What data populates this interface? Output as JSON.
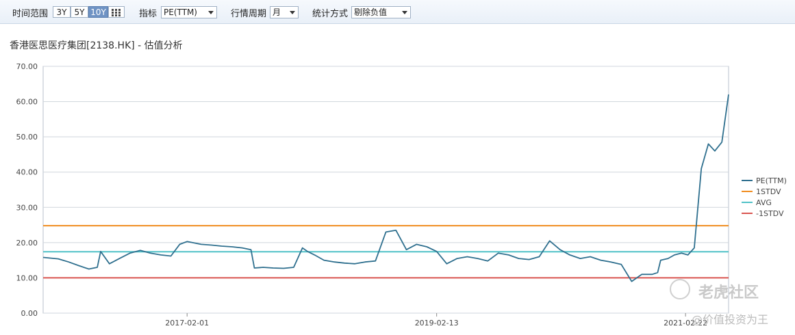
{
  "toolbar": {
    "time_range_label": "时间范围",
    "range_buttons": [
      "3Y",
      "5Y",
      "10Y"
    ],
    "active_range": "10Y",
    "indicator_label": "指标",
    "indicator_value": "PE(TTM)",
    "period_label": "行情周期",
    "period_value": "月",
    "method_label": "统计方式",
    "method_value": "剔除负值"
  },
  "watermark": {
    "brand": "老虎社区",
    "author": "@价值投资为王"
  },
  "chart_data": {
    "type": "line",
    "title": "香港医思医疗集团[2138.HK] - 估值分析",
    "xlabel": "",
    "ylabel": "",
    "ylim": [
      0,
      70
    ],
    "y_ticks": [
      "0.00",
      "10.00",
      "20.00",
      "30.00",
      "40.00",
      "50.00",
      "60.00",
      "70.00"
    ],
    "x_tick_labels": [
      "2017-02-01",
      "2019-02-13",
      "2021-02-22"
    ],
    "x_range": [
      "2015-12-01",
      "2021-06-30"
    ],
    "grid": true,
    "legend_position": "right",
    "series": [
      {
        "name": "PE(TTM)",
        "color": "#2e6f8e",
        "x": [
          "2015-12-01",
          "2016-01-15",
          "2016-02-15",
          "2016-03-15",
          "2016-04-15",
          "2016-05-10",
          "2016-05-20",
          "2016-06-15",
          "2016-07-15",
          "2016-08-15",
          "2016-09-15",
          "2016-10-15",
          "2016-11-15",
          "2016-12-15",
          "2017-01-10",
          "2017-02-01",
          "2017-03-15",
          "2017-04-15",
          "2017-05-15",
          "2017-06-15",
          "2017-07-15",
          "2017-08-10",
          "2017-08-20",
          "2017-09-15",
          "2017-10-15",
          "2017-11-15",
          "2017-12-15",
          "2018-01-10",
          "2018-01-25",
          "2018-02-15",
          "2018-03-15",
          "2018-04-15",
          "2018-05-15",
          "2018-06-15",
          "2018-07-15",
          "2018-08-15",
          "2018-09-15",
          "2018-10-15",
          "2018-11-15",
          "2018-12-15",
          "2019-01-15",
          "2019-02-13",
          "2019-03-15",
          "2019-04-15",
          "2019-05-15",
          "2019-06-15",
          "2019-07-15",
          "2019-08-15",
          "2019-09-15",
          "2019-10-15",
          "2019-11-15",
          "2019-12-15",
          "2020-01-15",
          "2020-02-15",
          "2020-03-15",
          "2020-04-15",
          "2020-05-15",
          "2020-06-15",
          "2020-07-15",
          "2020-08-15",
          "2020-09-15",
          "2020-10-15",
          "2020-11-15",
          "2020-12-01",
          "2020-12-10",
          "2021-01-01",
          "2021-01-20",
          "2021-02-10",
          "2021-03-01",
          "2021-03-20",
          "2021-04-10",
          "2021-05-01",
          "2021-05-20",
          "2021-06-10",
          "2021-06-30"
        ],
        "values": [
          15.8,
          15.4,
          14.5,
          13.5,
          12.5,
          13.0,
          17.5,
          14.0,
          15.5,
          17.0,
          17.8,
          17.0,
          16.5,
          16.2,
          19.5,
          20.3,
          19.5,
          19.3,
          19.0,
          18.8,
          18.5,
          18.0,
          12.8,
          13.0,
          12.8,
          12.7,
          13.0,
          18.5,
          17.5,
          16.5,
          15.0,
          14.5,
          14.2,
          14.0,
          14.5,
          14.8,
          23.0,
          23.5,
          18.0,
          19.5,
          18.8,
          17.5,
          14.0,
          15.5,
          16.0,
          15.5,
          14.8,
          17.0,
          16.5,
          15.5,
          15.2,
          16.0,
          20.5,
          18.0,
          16.5,
          15.5,
          16.0,
          15.0,
          14.5,
          13.8,
          9.0,
          11.0,
          11.0,
          11.5,
          15.0,
          15.5,
          16.5,
          17.0,
          16.5,
          18.5,
          41.0,
          48.0,
          46.0,
          48.5,
          62.0
        ]
      },
      {
        "name": "1STDV",
        "color": "#f08c1e",
        "values": [
          24.8
        ]
      },
      {
        "name": "AVG",
        "color": "#4fc1c7",
        "values": [
          17.4
        ]
      },
      {
        "name": "-1STDV",
        "color": "#d9534f",
        "values": [
          10.0
        ]
      }
    ]
  }
}
